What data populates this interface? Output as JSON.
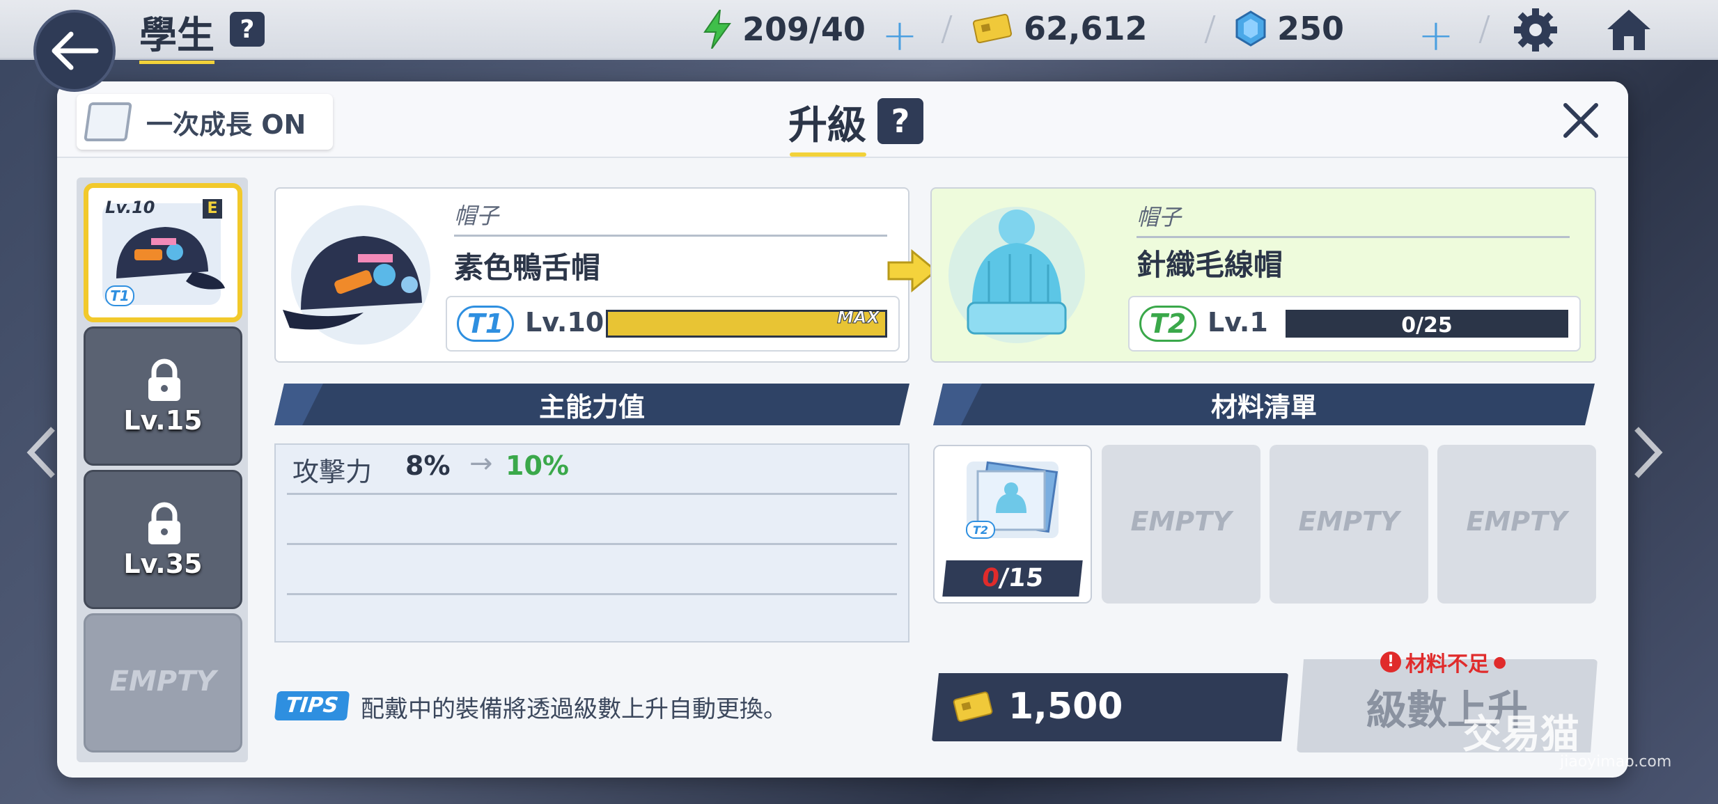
{
  "topbar": {
    "title": "學生",
    "help": "?",
    "ap": "209/40",
    "credits": "62,612",
    "gems": "250"
  },
  "modal": {
    "toggle_label": "一次成長 ON",
    "title": "升級",
    "help": "?"
  },
  "sidebar": {
    "slots": [
      {
        "level": "Lv.10",
        "grade": "E",
        "tier": "T1"
      },
      {
        "level": "Lv.15"
      },
      {
        "level": "Lv.35"
      },
      {
        "label": "EMPTY"
      }
    ]
  },
  "current": {
    "category": "帽子",
    "name": "素色鴨舌帽",
    "tier": "T1",
    "level": "Lv.10",
    "max_label": "MAX",
    "progress": 1.0
  },
  "next": {
    "category": "帽子",
    "name": "針織毛線帽",
    "tier": "T2",
    "level": "Lv.1",
    "exp": "0/25",
    "progress": 0.0
  },
  "stats": {
    "header": "主能力值",
    "rows": [
      {
        "name": "攻擊力",
        "from": "8%",
        "arrow": "→",
        "to": "10%"
      }
    ]
  },
  "materials": {
    "header": "材料清單",
    "items": [
      {
        "tier": "T2",
        "have": "0",
        "need": "/15"
      }
    ],
    "empty_label": "EMPTY"
  },
  "tips": {
    "badge": "TIPS",
    "text": "配戴中的裝備將透過級數上升自動更換。"
  },
  "cost": "1,500",
  "levelup": {
    "label": "級數上升",
    "warning": "材料不足",
    "warning_icon": "!"
  },
  "watermark": {
    "text": "交易猫",
    "sub": "jiaoyimao.com"
  },
  "colors": {
    "accent_yellow": "#f2d23a",
    "navy": "#2f3b56",
    "green": "#3aa84a",
    "red": "#e02b2b",
    "blue": "#2e8fe0"
  }
}
